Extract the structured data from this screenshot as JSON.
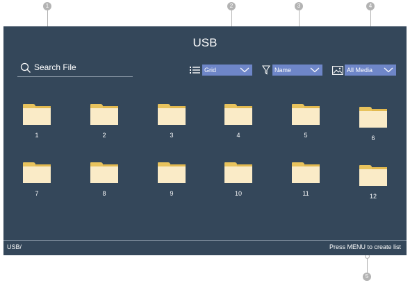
{
  "callouts": [
    "1",
    "2",
    "3",
    "4",
    "5"
  ],
  "header": {
    "title": "USB"
  },
  "search": {
    "placeholder": "Search File"
  },
  "controls": {
    "view": {
      "icon": "list-view-icon",
      "value": "Grid"
    },
    "sort": {
      "icon": "filter-icon",
      "value": "Name"
    },
    "media": {
      "icon": "image-icon",
      "value": "All Media"
    }
  },
  "folders": [
    "1",
    "2",
    "3",
    "4",
    "5",
    "6",
    "7",
    "8",
    "9",
    "10",
    "11",
    "12"
  ],
  "footer": {
    "path": "USB/",
    "hint": "Press MENU to create list"
  },
  "colors": {
    "screen_bg": "#34475a",
    "dropdown_bg": "#6e86c8",
    "folder_front": "#faebc7",
    "folder_back": "#e2b94f"
  }
}
